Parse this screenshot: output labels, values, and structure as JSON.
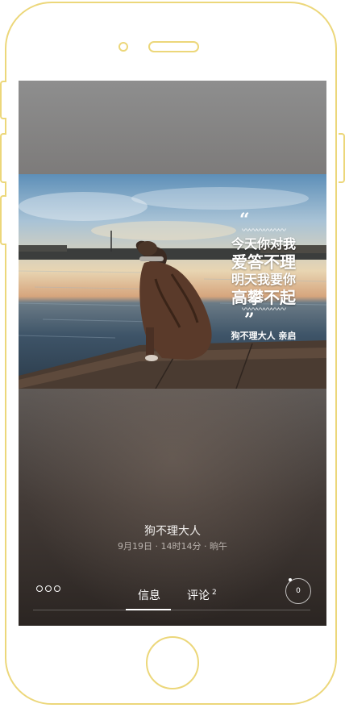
{
  "post": {
    "image_caption": {
      "open_quote": "“",
      "line1": "今天你对我",
      "line2": "爱答不理",
      "line3": "明天我要你",
      "line4": "高攀不起",
      "close_quote": "”",
      "signature": "狗不理大人  亲启"
    },
    "author": "狗不理大人",
    "meta": "9月19日 · 14时14分 · 晌午"
  },
  "bottom_bar": {
    "more_icon": "more-dots-icon",
    "tabs": [
      {
        "label": "信息",
        "active": true
      },
      {
        "label": "评论",
        "count": "2",
        "active": false
      }
    ],
    "like_count": "0"
  },
  "colors": {
    "frame": "#ecd77a",
    "text_primary": "#f1efed",
    "text_secondary": "#b9b2ad"
  }
}
